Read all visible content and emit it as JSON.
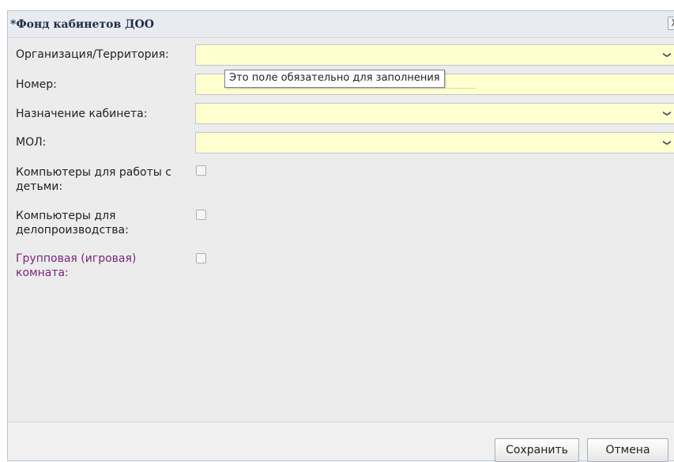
{
  "window": {
    "title": "*Фонд кабинетов ДОО",
    "close_label": "X"
  },
  "form": {
    "organization": {
      "label": "Организация/Территория:",
      "value": "",
      "down_icon": "❯",
      "more_icon": "···"
    },
    "number": {
      "label": "Номер:",
      "value": ""
    },
    "purpose": {
      "label": "Назначение кабинета:",
      "value": "",
      "down_icon": "❯",
      "more_icon": "···"
    },
    "mol": {
      "label": "МОЛ:",
      "value": "",
      "down_icon": "❯",
      "more_icon": "···"
    },
    "children_computers": {
      "label_line1": "Компьютеры для работы с",
      "label_line2": "детьми:",
      "checked": false
    },
    "office_computers": {
      "label_line1": "Компьютеры для",
      "label_line2": "делопроизводства:",
      "checked": false
    },
    "group_room": {
      "label_line1": "Групповая (игровая)",
      "label_line2": "комната:",
      "checked": false
    }
  },
  "tooltip": {
    "text": "Это поле обязательно для заполнения"
  },
  "buttons": {
    "save": "Сохранить",
    "cancel": "Отмена"
  },
  "colors": {
    "required_field_bg": "#ffffd0",
    "purple_label": "#7a257d",
    "title_text": "#1e2d4a"
  }
}
